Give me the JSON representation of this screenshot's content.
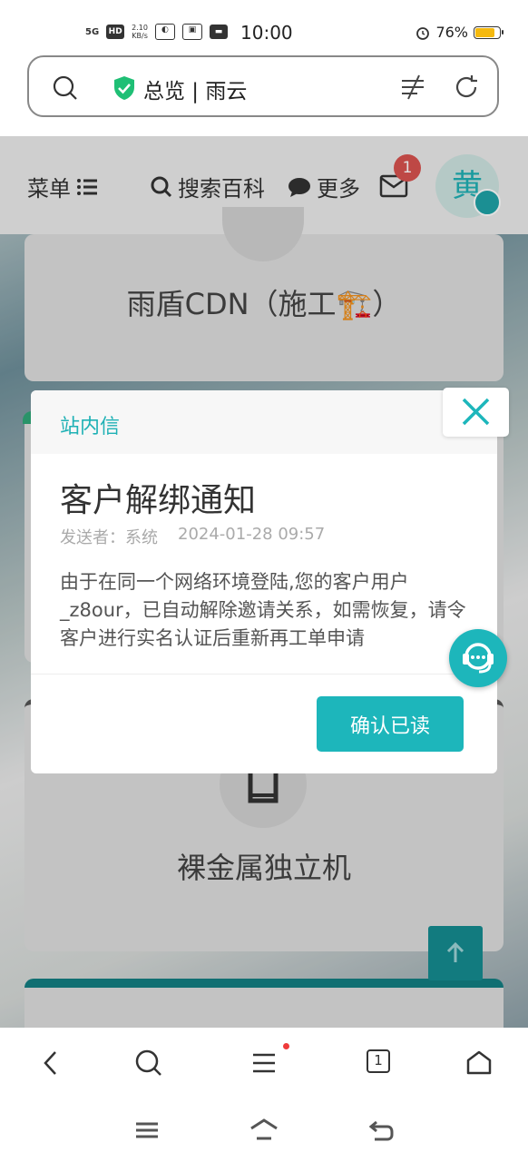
{
  "status_bar": {
    "signal": "5G",
    "hd": "HD",
    "speed_value": "2.10",
    "speed_unit": "KB/s",
    "time": "10:00",
    "battery": "76%",
    "battery_level": 0.76
  },
  "address_bar": {
    "title": "总览 | 雨云"
  },
  "site_nav": {
    "menu_label": "菜单",
    "search_label": "搜索百科",
    "more_label": "更多",
    "mail_count": "1",
    "avatar_char": "黄"
  },
  "cards": {
    "cdn_label": "雨盾CDN（施工🏗️）",
    "bare_metal_label": "裸金属独立机"
  },
  "modal": {
    "header_title": "站内信",
    "heading": "客户解绑通知",
    "sender": "发送者：系统",
    "datetime": "2024-01-28 09:57",
    "body": "由于在同一个网络环境登陆,您的客户用户_z8our，已自动解除邀请关系，如需恢复，请令客户进行实名认证后重新再工单申请",
    "confirm_label": "确认已读"
  },
  "toolbar": {
    "tab_count": "1"
  },
  "colors": {
    "accent": "#1db6bb",
    "badge": "#d9534f",
    "shield": "#1fbf75"
  },
  "icons": [
    "search-icon",
    "shield-icon",
    "reader-mode-icon",
    "reload-icon",
    "menu-list-icon",
    "message-icon",
    "mail-icon",
    "close-icon",
    "headset-icon",
    "arrow-up-icon",
    "back-icon",
    "home-icon",
    "recent-apps-icon"
  ]
}
